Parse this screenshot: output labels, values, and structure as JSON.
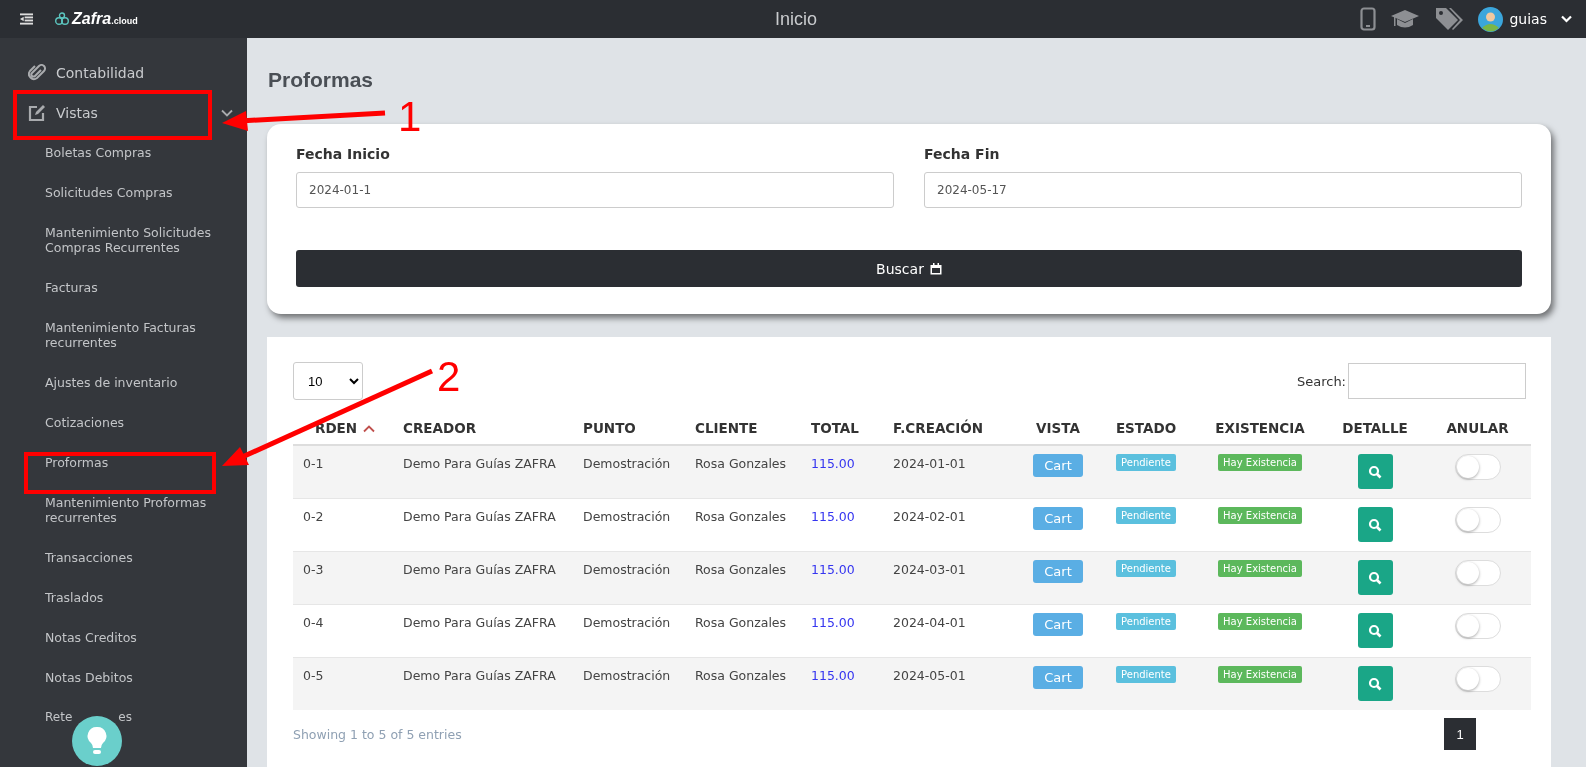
{
  "topbar": {
    "logo": "Zafra",
    "logo_suffix": ".cloud",
    "title": "Inicio",
    "user": "guias"
  },
  "sidebar": {
    "items": [
      {
        "label": "Contabilidad",
        "kind": "section",
        "expanded": false
      },
      {
        "label": "Vistas",
        "kind": "section",
        "expanded": true
      },
      {
        "label": "Boletas Compras",
        "kind": "sub"
      },
      {
        "label": "Solicitudes Compras",
        "kind": "sub"
      },
      {
        "label": "Mantenimiento Solicitudes Compras Recurrentes",
        "kind": "sub"
      },
      {
        "label": "Facturas",
        "kind": "sub"
      },
      {
        "label": "Mantenimiento Facturas recurrentes",
        "kind": "sub"
      },
      {
        "label": "Ajustes de inventario",
        "kind": "sub"
      },
      {
        "label": "Cotizaciones",
        "kind": "sub"
      },
      {
        "label": "Proformas",
        "kind": "sub"
      },
      {
        "label": "Mantenimiento Proformas recurrentes",
        "kind": "sub"
      },
      {
        "label": "Transacciones",
        "kind": "sub"
      },
      {
        "label": "Traslados",
        "kind": "sub"
      },
      {
        "label": "Notas Creditos",
        "kind": "sub"
      },
      {
        "label": "Notas Debitos",
        "kind": "sub"
      },
      {
        "label": "Rete",
        "label_tail": "es",
        "kind": "sub"
      }
    ]
  },
  "page_title": "Proformas",
  "filters": {
    "fields": [
      {
        "label": "Fecha Inicio",
        "value": "2024-01-1"
      },
      {
        "label": "Fecha Fin",
        "value": "2024-05-17"
      }
    ],
    "button": "Buscar"
  },
  "table": {
    "page_size": "10",
    "search_label": "Search:",
    "columns": [
      "RDEN",
      "CREADOR",
      "PUNTO",
      "CLIENTE",
      "TOTAL",
      "F.CREACIÓN",
      "VISTA",
      "ESTADO",
      "EXISTENCIA",
      "DETALLE",
      "ANULAR"
    ],
    "rows": [
      {
        "orden": "0-1",
        "creador": "Demo Para Guías ZAFRA",
        "punto": "Demostración",
        "cliente": "Rosa Gonzales",
        "total": "115.00",
        "fecha": "2024-01-01",
        "vista": "Cart",
        "estado": "Pendiente",
        "existencia": "Hay Existencia",
        "anular_on": false
      },
      {
        "orden": "0-2",
        "creador": "Demo Para Guías ZAFRA",
        "punto": "Demostración",
        "cliente": "Rosa Gonzales",
        "total": "115.00",
        "fecha": "2024-02-01",
        "vista": "Cart",
        "estado": "Pendiente",
        "existencia": "Hay Existencia",
        "anular_on": false
      },
      {
        "orden": "0-3",
        "creador": "Demo Para Guías ZAFRA",
        "punto": "Demostración",
        "cliente": "Rosa Gonzales",
        "total": "115.00",
        "fecha": "2024-03-01",
        "vista": "Cart",
        "estado": "Pendiente",
        "existencia": "Hay Existencia",
        "anular_on": false
      },
      {
        "orden": "0-4",
        "creador": "Demo Para Guías ZAFRA",
        "punto": "Demostración",
        "cliente": "Rosa Gonzales",
        "total": "115.00",
        "fecha": "2024-04-01",
        "vista": "Cart",
        "estado": "Pendiente",
        "existencia": "Hay Existencia",
        "anular_on": false
      },
      {
        "orden": "0-5",
        "creador": "Demo Para Guías ZAFRA",
        "punto": "Demostración",
        "cliente": "Rosa Gonzales",
        "total": "115.00",
        "fecha": "2024-05-01",
        "vista": "Cart",
        "estado": "Pendiente",
        "existencia": "Hay Existencia",
        "anular_on": false
      }
    ],
    "info": "Showing 1 to 5 of 5 entries",
    "pages": [
      {
        "label": "1",
        "selected": true
      }
    ]
  },
  "annotations": [
    {
      "label": "1"
    },
    {
      "label": "2"
    }
  ]
}
